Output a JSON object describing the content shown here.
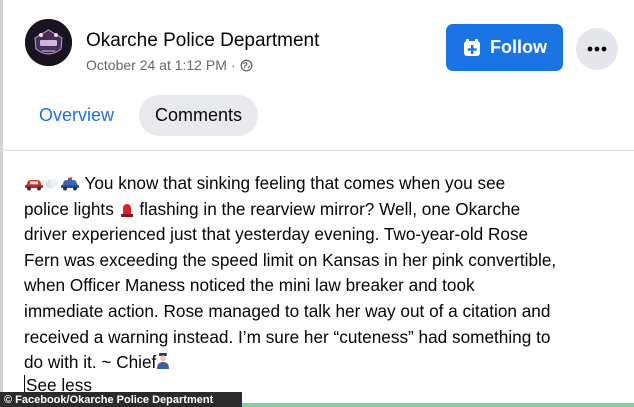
{
  "post": {
    "page_name": "Okarche Police Department",
    "date": "October 24 at 1:12 PM",
    "separator": "·",
    "privacy_icon": "globe-icon",
    "follow_label": "Follow",
    "more_icon": "more-dots-icon"
  },
  "tabs": [
    {
      "label": "Overview",
      "active": false
    },
    {
      "label": "Comments",
      "active": true
    }
  ],
  "body": {
    "line1": " You know that sinking feeling that comes when you see",
    "line2a": "police lights ",
    "line2b": " flashing in the rearview mirror? Well, one Okarche",
    "line3": "driver experienced just that yesterday evening. Two-year-old Rose",
    "line4": "Fern was exceeding the speed limit on Kansas in her pink convertible,",
    "line5": "when Officer Maness noticed the mini law breaker and took",
    "line6": "immediate action. Rose managed to talk her way out of a citation and",
    "line7": "received a warning instead. I’m sure her “cuteness” had something to",
    "line8": "do with it. ~ Chief",
    "see_less": "See less"
  },
  "watermark": "© Facebook/Okarche Police Department",
  "colors": {
    "accent": "#1b74e4",
    "tab_active_text": "#216fdb",
    "meta_text": "#65676b"
  }
}
